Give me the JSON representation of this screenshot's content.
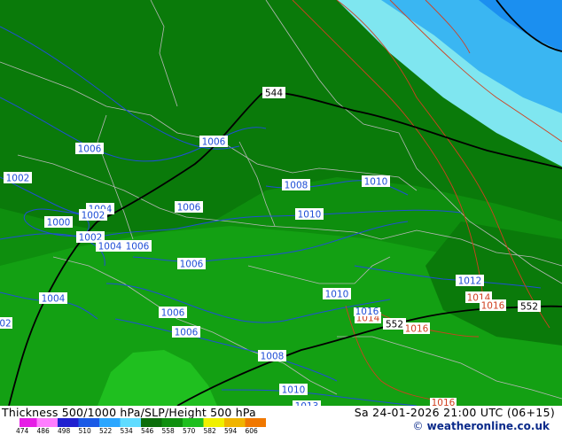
{
  "map": {
    "colors": {
      "land_dark": "#0a7a0a",
      "land_mid": "#0e8e0e",
      "land_light": "#13a013",
      "land_bright": "#1fbf1f",
      "cold_light": "#7fe6f0",
      "cold_mid": "#3ab6f2",
      "cold_deep": "#1b8ff0",
      "isobar": "#1f4fd6",
      "isobar_warm": "#d04020",
      "thickness_line": "#000000",
      "border": "#b8b8b8"
    },
    "isobar_labels_blue": [
      "1006",
      "1006",
      "1002",
      "1004",
      "1000",
      "1002",
      "1002",
      "1004",
      "1006",
      "1006",
      "1008",
      "1010",
      "1010",
      "1006",
      "1010",
      "1004",
      "1006",
      "1006",
      "1008",
      "1012",
      "1010",
      "1013",
      "02"
    ],
    "isobar_labels_warm": [
      "1014",
      "1016",
      "1016",
      "1014",
      "1016",
      "1016"
    ],
    "thickness_labels": [
      "544",
      "552",
      "552"
    ]
  },
  "bottom": {
    "title": "Thickness 500/1000 hPa/SLP/Height 500 hPa",
    "datetime": "Sa 24-01-2026 21:00 UTC (06+15)",
    "credit": "weatheronline.co.uk",
    "credit_symbol": "©",
    "scale_labels": [
      "474",
      "486",
      "498",
      "510",
      "522",
      "534",
      "546",
      "558",
      "570",
      "582",
      "594",
      "606"
    ],
    "scale_colors": [
      "#e61ee6",
      "#ff7dff",
      "#2020d0",
      "#1a5ae6",
      "#2aa6ff",
      "#5fdcff",
      "#0b6e0b",
      "#0f8f0f",
      "#1fbf1f",
      "#f0f000",
      "#f0b400",
      "#f07800"
    ]
  }
}
